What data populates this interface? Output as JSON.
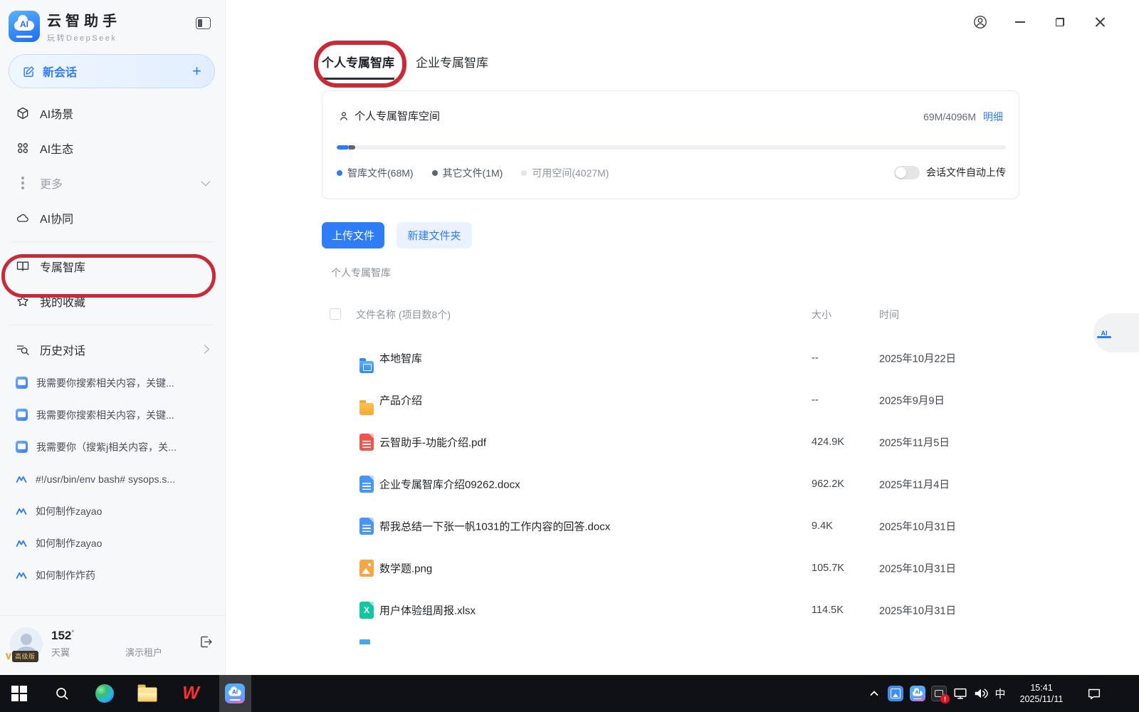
{
  "app": {
    "name": "云智助手",
    "tagline": "玩转DeepSeek"
  },
  "sidebar": {
    "new_chat_label": "新会话",
    "nav_ai_scenes": "AI场景",
    "nav_ai_ecosystem": "AI生态",
    "nav_more": "更多",
    "nav_ai_collab": "AI协同",
    "nav_knowledge_base": "专属智库",
    "nav_favorites": "我的收藏",
    "history_label": "历史对话",
    "history_items": [
      "我需要你搜索相关内容，关键...",
      "我需要你搜索相关内容，关键...",
      "我需要你（搜紫j相关内容，关...",
      "#!/usr/bin/env bash# sysops.s...",
      "如何制作zayao",
      "如何制作zayao",
      "如何制作炸药"
    ],
    "user": {
      "name": "152",
      "name_mask": "*",
      "vip_v": "V",
      "vip_text": "高级版",
      "org_prefix": "天翼",
      "org_suffix": "演示租户"
    }
  },
  "main": {
    "tabs": {
      "personal": "个人专属智库",
      "enterprise": "企业专属智库"
    },
    "storage": {
      "title": "个人专属智库空间",
      "usage": "69M/4096M",
      "detail_link": "明细",
      "legend_kb": "智库文件(68M)",
      "legend_other": "其它文件(1M)",
      "legend_free": "可用空间(4027M)",
      "auto_upload_label": "会话文件自动上传"
    },
    "upload_button": "上传文件",
    "new_folder_button": "新建文件夹",
    "breadcrumb": "个人专属智库",
    "table": {
      "name_header": "文件名称 (项目数8个)",
      "size_header": "大小",
      "time_header": "时间",
      "rows": [
        {
          "name": "本地智库",
          "type": "folder-local",
          "size": "--",
          "time": "2025年10月22日"
        },
        {
          "name": "产品介绍",
          "type": "folder",
          "size": "--",
          "time": "2025年9月9日"
        },
        {
          "name": "云智助手-功能介绍.pdf",
          "type": "pdf",
          "size": "424.9K",
          "time": "2025年11月5日"
        },
        {
          "name": "企业专属智库介绍09262.docx",
          "type": "docx",
          "size": "962.2K",
          "time": "2025年11月4日"
        },
        {
          "name": "帮我总结一下张一帆1031的工作内容的回答.docx",
          "type": "docx",
          "size": "9.4K",
          "time": "2025年10月31日"
        },
        {
          "name": "数学题.png",
          "type": "png",
          "size": "105.7K",
          "time": "2025年10月31日"
        },
        {
          "name": "用户体验组周报.xlsx",
          "type": "xlsx",
          "size": "114.5K",
          "time": "2025年10月31日"
        }
      ]
    }
  },
  "taskbar": {
    "ime": "中",
    "time": "15:41",
    "date": "2025/11/11"
  },
  "colors": {
    "accent": "#2e7cf6",
    "annotation": "#cc2936",
    "legend_kb": "#2e7cf6",
    "legend_other": "#5b6473",
    "legend_free": "#e3e5e9"
  }
}
